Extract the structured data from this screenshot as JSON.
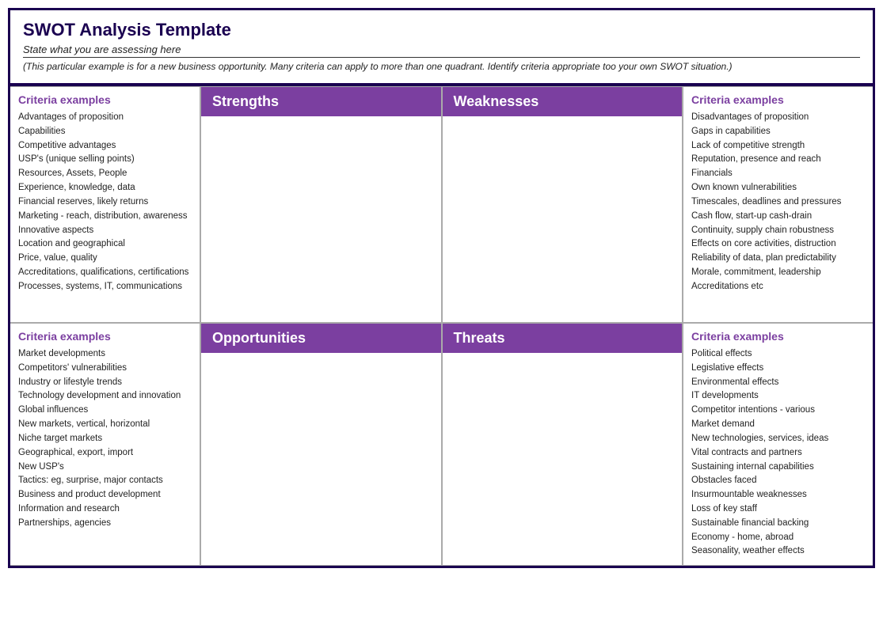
{
  "header": {
    "title": "SWOT Analysis Template",
    "subtitle": "State what you are assessing here",
    "note": "(This particular example is for a new business opportunity. Many criteria can apply to more than one quadrant. Identify criteria appropriate too your own SWOT situation.)"
  },
  "topLeft": {
    "title": "Criteria examples",
    "items": [
      "Advantages of proposition",
      "Capabilities",
      "Competitive advantages",
      "USP's (unique selling points)",
      "Resources, Assets, People",
      "Experience, knowledge, data",
      "Financial reserves, likely returns",
      "Marketing -  reach, distribution, awareness",
      "Innovative aspects",
      "Location and geographical",
      "Price, value, quality",
      "Accreditations, qualifications, certifications",
      "Processes, systems, IT, communications"
    ]
  },
  "topRight": {
    "title": "Criteria examples",
    "items": [
      "Disadvantages of proposition",
      "Gaps in capabilities",
      "Lack of competitive strength",
      "Reputation, presence and reach",
      "Financials",
      "Own known vulnerabilities",
      "Timescales, deadlines and pressures",
      "Cash flow, start-up cash-drain",
      "Continuity, supply chain robustness",
      "Effects on core activities, distruction",
      "Reliability of data, plan predictability",
      "Morale, commitment, leadership",
      "Accreditations etc"
    ]
  },
  "bottomLeft": {
    "title": "Criteria examples",
    "items": [
      "Market developments",
      "Competitors' vulnerabilities",
      "Industry or lifestyle trends",
      "Technology development and innovation",
      "Global influences",
      "New markets, vertical, horizontal",
      "Niche target markets",
      "Geographical, export, import",
      "New USP's",
      "Tactics: eg, surprise, major contacts",
      "Business and product development",
      "Information and research",
      "Partnerships, agencies"
    ]
  },
  "bottomRight": {
    "title": "Criteria examples",
    "items": [
      "Political effects",
      "Legislative effects",
      "Environmental effects",
      "IT developments",
      "Competitor intentions - various",
      "Market demand",
      "New technologies, services, ideas",
      "Vital contracts and partners",
      "Sustaining internal capabilities",
      "Obstacles faced",
      "Insurmountable weaknesses",
      "Loss of key staff",
      "Sustainable financial backing",
      "Economy - home, abroad",
      "Seasonality, weather effects"
    ]
  },
  "quadrants": {
    "strengths": "Strengths",
    "weaknesses": "Weaknesses",
    "opportunities": "Opportunities",
    "threats": "Threats"
  }
}
